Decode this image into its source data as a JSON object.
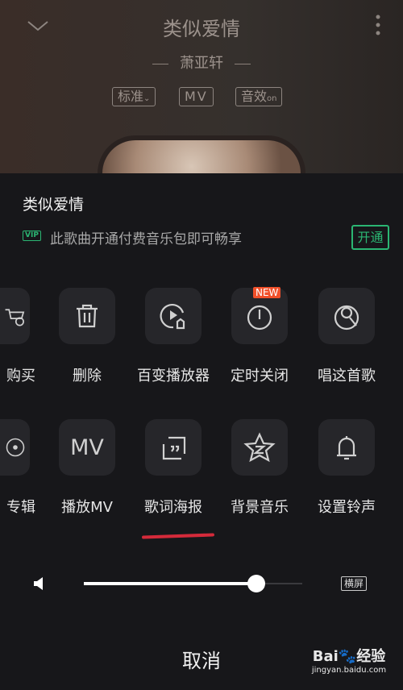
{
  "header": {
    "title": "类似爱情",
    "artist": "萧亚轩",
    "tags": [
      "标准",
      "MV",
      "音效"
    ],
    "tag_suffix": "on",
    "icons": [
      "chevron-down-icon",
      "more-vertical-icon"
    ]
  },
  "sheet": {
    "song_title": "类似爱情",
    "vip_badge": "VIP",
    "vip_text": "此歌曲开通付费音乐包即可畅享",
    "open_button": "开通",
    "accent": "#2bb673",
    "row1": [
      {
        "label": "购买",
        "icon": "cart-icon"
      },
      {
        "label": "删除",
        "icon": "trash-icon"
      },
      {
        "label": "百变播放器",
        "icon": "player-skin-icon"
      },
      {
        "label": "定时关闭",
        "icon": "timer-icon",
        "badge": "NEW"
      },
      {
        "label": "唱这首歌",
        "icon": "karaoke-icon"
      }
    ],
    "row2": [
      {
        "label": "专辑",
        "icon": "album-icon"
      },
      {
        "label": "播放MV",
        "icon": "mv-icon",
        "glyph": "MV"
      },
      {
        "label": "歌词海报",
        "icon": "lyrics-poster-icon"
      },
      {
        "label": "背景音乐",
        "icon": "qzone-star-icon"
      },
      {
        "label": "设置铃声",
        "icon": "bell-icon"
      }
    ],
    "volume": 0.79,
    "landscape": "横屏",
    "cancel": "取消"
  },
  "watermark": {
    "brand": "Bai经验",
    "url": "jingyan.baidu.com"
  }
}
